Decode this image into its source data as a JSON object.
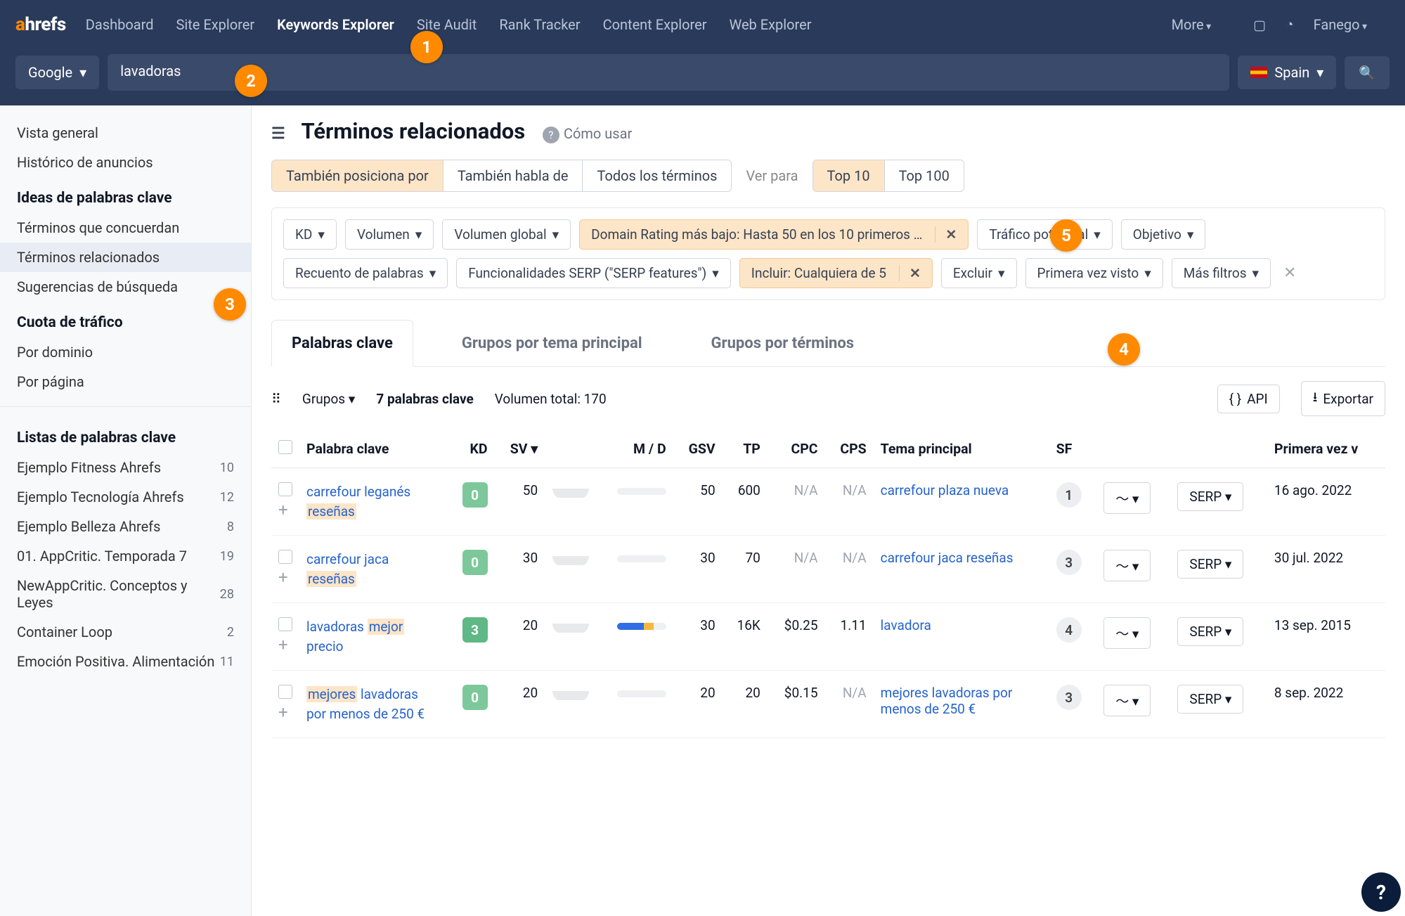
{
  "nav": {
    "logo_a": "a",
    "logo_rest": "hrefs",
    "items": [
      "Dashboard",
      "Site Explorer",
      "Keywords Explorer",
      "Site Audit",
      "Rank Tracker",
      "Content Explorer",
      "Web Explorer"
    ],
    "active_index": 2,
    "more": "More",
    "user": "Fanego"
  },
  "search": {
    "engine": "Google",
    "keyword": "lavadoras",
    "country": "Spain"
  },
  "sidebar": {
    "top": [
      "Vista general",
      "Histórico de anuncios"
    ],
    "ideas_heading": "Ideas de palabras clave",
    "ideas": [
      "Términos que concuerdan",
      "Términos relacionados",
      "Sugerencias de búsqueda"
    ],
    "ideas_active": 1,
    "traffic_heading": "Cuota de tráfico",
    "traffic": [
      "Por dominio",
      "Por página"
    ],
    "lists_heading": "Listas de palabras clave",
    "lists": [
      {
        "name": "Ejemplo Fitness Ahrefs",
        "count": "10"
      },
      {
        "name": "Ejemplo Tecnología Ahrefs",
        "count": "12"
      },
      {
        "name": "Ejemplo Belleza Ahrefs",
        "count": "8"
      },
      {
        "name": "01. AppCritic. Temporada 7",
        "count": "19"
      },
      {
        "name": "NewAppCritic. Conceptos y Leyes",
        "count": "28"
      },
      {
        "name": "Container Loop",
        "count": "2"
      },
      {
        "name": "Emoción Positiva. Alimentación",
        "count": "11"
      }
    ]
  },
  "page": {
    "title": "Términos relacionados",
    "howto": "Cómo usar",
    "match_tabs": [
      "También posiciona por",
      "También habla de",
      "Todos los términos"
    ],
    "match_sel": 0,
    "ver_para": "Ver para",
    "top_tabs": [
      "Top 10",
      "Top 100"
    ],
    "top_sel": 0,
    "filters": {
      "kd": "KD",
      "vol": "Volumen",
      "gvol": "Volumen global",
      "dr": "Domain Rating más bajo: Hasta 50 en los 10 primeros …",
      "tp": "Tráfico potencial",
      "obj": "Objetivo",
      "wc": "Recuento de palabras",
      "serp": "Funcionalidades SERP (\"SERP features\")",
      "incl": "Incluir: Cualquiera de 5",
      "excl": "Excluir",
      "first": "Primera vez visto",
      "more": "Más filtros"
    },
    "subtabs": [
      "Palabras clave",
      "Grupos por tema principal",
      "Grupos por términos"
    ],
    "subtab_sel": 0,
    "groups": "Grupos",
    "kw_count": "7 palabras clave",
    "vol_total": "Volumen total: 170",
    "api": "API",
    "export": "Exportar",
    "cols": {
      "kw": "Palabra clave",
      "kd": "KD",
      "sv": "SV",
      "md": "M / D",
      "gsv": "GSV",
      "tp": "TP",
      "cpc": "CPC",
      "cps": "CPS",
      "theme": "Tema principal",
      "sf": "SF",
      "first": "Primera vez v"
    },
    "serp_label": "SERP",
    "rows": [
      {
        "kw_pre": "carrefour leganés ",
        "kw_hl": "reseñas",
        "kd": "0",
        "kd_c": "kd0",
        "sv": "50",
        "gsv": "50",
        "tp": "600",
        "cpc": "N/A",
        "cps": "N/A",
        "theme": "carrefour plaza nueva",
        "sf": "1",
        "first": "16 ago. 2022",
        "md": 0
      },
      {
        "kw_pre": "carrefour jaca ",
        "kw_hl": "reseñas",
        "kd": "0",
        "kd_c": "kd0",
        "sv": "30",
        "gsv": "30",
        "tp": "70",
        "cpc": "N/A",
        "cps": "N/A",
        "theme": "carrefour jaca reseñas",
        "sf": "3",
        "first": "30 jul. 2022",
        "md": 0
      },
      {
        "kw_pre": "lavadoras ",
        "kw_hl": "mejor",
        "kw_post": " precio",
        "kd": "3",
        "kd_c": "kd3",
        "sv": "20",
        "gsv": "30",
        "tp": "16K",
        "cpc": "$0.25",
        "cps": "1.11",
        "theme": "lavadora",
        "sf": "4",
        "first": "13 sep. 2015",
        "md": 1
      },
      {
        "kw_hl": "mejores",
        "kw_post": " lavadoras por menos de 250 €",
        "kd": "0",
        "kd_c": "kd0",
        "sv": "20",
        "gsv": "20",
        "tp": "20",
        "cpc": "$0.15",
        "cps": "N/A",
        "theme": "mejores lavadoras por menos de 250 €",
        "sf": "3",
        "first": "8 sep. 2022",
        "md": 0
      }
    ]
  },
  "callouts": {
    "1": "1",
    "2": "2",
    "3": "3",
    "4": "4",
    "5": "5"
  },
  "help": "?"
}
